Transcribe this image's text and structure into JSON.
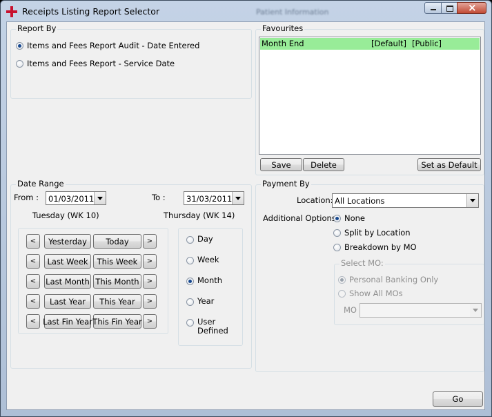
{
  "window": {
    "title": "Receipts Listing Report Selector",
    "background_title": "Patient Information"
  },
  "report_by": {
    "title": "Report By",
    "options": [
      {
        "label": "Items and Fees Report Audit - Date Entered",
        "selected": true
      },
      {
        "label": "Items and Fees Report - Service Date",
        "selected": false
      }
    ]
  },
  "favourites": {
    "title": "Favourites",
    "items": [
      {
        "name": "Month End",
        "default": "[Default]",
        "visibility": "[Public]",
        "selected": true
      }
    ],
    "highlight_color": "#98ec98",
    "save_label": "Save",
    "delete_label": "Delete",
    "set_default_label": "Set as Default"
  },
  "date_range": {
    "title": "Date Range",
    "from_label": "From :",
    "from_value": "01/03/2011",
    "from_day": "Tuesday (WK 10)",
    "to_label": "To :",
    "to_value": "31/03/2011",
    "to_day": "Thursday (WK 14)",
    "prev_label": "<",
    "next_label": ">",
    "quick_buttons": [
      [
        "Yesterday",
        "Today"
      ],
      [
        "Last Week",
        "This Week"
      ],
      [
        "Last Month",
        "This Month"
      ],
      [
        "Last Year",
        "This Year"
      ],
      [
        "Last Fin Year",
        "This Fin Year"
      ]
    ],
    "periods": [
      {
        "label": "Day",
        "selected": false
      },
      {
        "label": "Week",
        "selected": false
      },
      {
        "label": "Month",
        "selected": true
      },
      {
        "label": "Year",
        "selected": false
      },
      {
        "label": "User\nDefined",
        "selected": false
      }
    ]
  },
  "payment_by": {
    "title": "Payment By",
    "location_label": "Location:",
    "location_value": "All Locations",
    "additional_label": "Additional Options:",
    "options": [
      {
        "label": "None",
        "selected": true
      },
      {
        "label": "Split by Location",
        "selected": false
      },
      {
        "label": "Breakdown by MO",
        "selected": false
      }
    ],
    "select_mo": {
      "title": "Select MO:",
      "options": [
        {
          "label": "Personal Banking Only",
          "selected": true
        },
        {
          "label": "Show All MOs",
          "selected": false
        }
      ],
      "mo_label": "MO",
      "mo_value": ""
    }
  },
  "footer": {
    "go_label": "Go"
  }
}
